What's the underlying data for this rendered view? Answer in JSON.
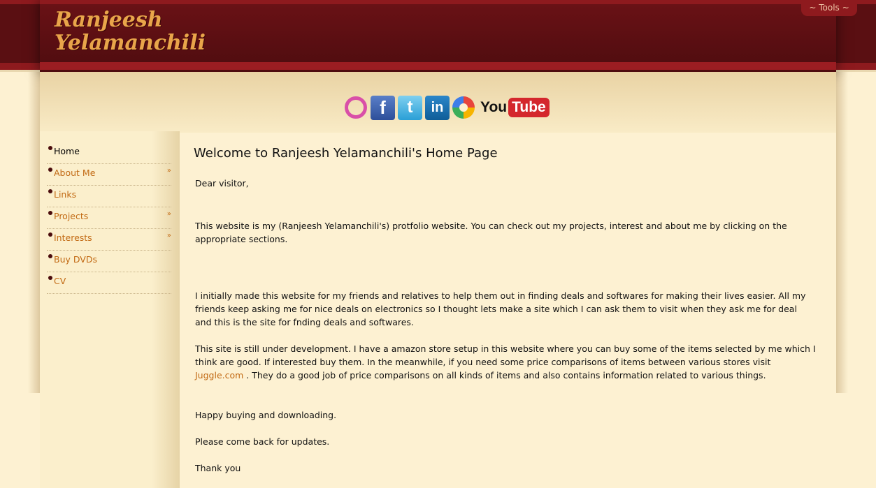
{
  "header": {
    "logo_line1": "Ranjeesh",
    "logo_line2": "Yelamanchili",
    "tools_label": "~ Tools ~"
  },
  "social": {
    "icons": [
      "orkut-icon",
      "facebook-icon",
      "twitter-icon",
      "linkedin-icon",
      "picasa-icon",
      "youtube-icon"
    ],
    "youtube_you": "You",
    "youtube_tube": "Tube"
  },
  "sidebar": {
    "items": [
      {
        "label": "Home",
        "active": true,
        "has_submenu": false
      },
      {
        "label": "About Me",
        "active": false,
        "has_submenu": true
      },
      {
        "label": "Links",
        "active": false,
        "has_submenu": false
      },
      {
        "label": "Projects",
        "active": false,
        "has_submenu": true
      },
      {
        "label": "Interests",
        "active": false,
        "has_submenu": true
      },
      {
        "label": "Buy DVDs",
        "active": false,
        "has_submenu": false
      },
      {
        "label": "CV",
        "active": false,
        "has_submenu": false
      }
    ],
    "submenu_arrow": "»"
  },
  "main": {
    "title": "Welcome to Ranjeesh Yelamanchili's Home Page",
    "greeting": "Dear visitor,",
    "para1": "This website is my (Ranjeesh Yelamanchili's) protfolio website. You can check out my projects, interest and about me by clicking on the appropriate sections.",
    "para2": "I initially made this website for my friends and relatives to help them out in finding deals and softwares for making their lives easier. All my friends keep asking me for nice deals on electronics so I thought lets make a site which I can ask them to visit when they ask me for deal and this is the site for fnding deals and softwares.",
    "para3_before": "This site is still under development. I have a amazon store setup in this website where you can buy some of the items selected by me which I think are good. If interested buy them. In the meanwhile, if you need some price comparisons of items between various stores visit ",
    "para3_link": "Juggle.com",
    "para3_after": " . They do a good job of price comparisons on all kinds of items and also contains information related to various things.",
    "para4": "Happy buying and downloading.",
    "para5": "Please come back for updates.",
    "para6": "Thank you"
  },
  "colors": {
    "header_dark": "#5a0f12",
    "header_red": "#8e1a1e",
    "background": "#fdf1d2",
    "link": "#c26a14"
  }
}
